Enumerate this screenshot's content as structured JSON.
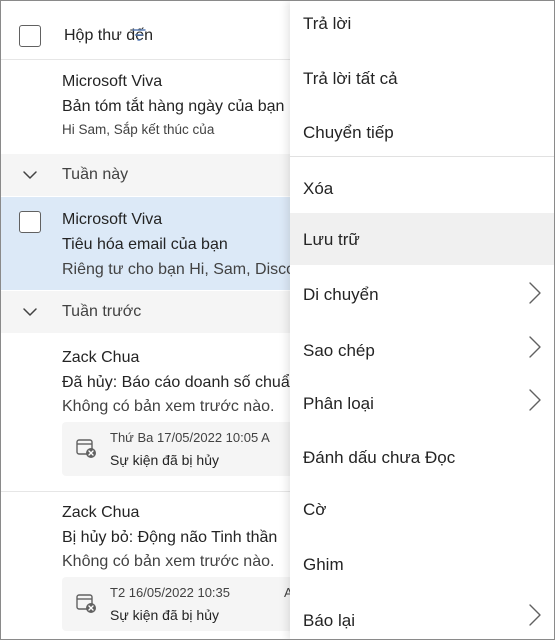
{
  "header": {
    "title": "Hộp thư đến"
  },
  "mails": [
    {
      "sender": "Microsoft Viva",
      "subject": "Bản tóm tắt hàng ngày của bạn",
      "preview": "Hi Sam, Sắp kết thúc của"
    },
    {
      "sender": "Microsoft Viva",
      "subject": "Tiêu hóa email của bạn",
      "preview": "Riêng tư cho bạn Hi, Sam, Disco"
    },
    {
      "sender": "Zack Chua",
      "subject": "Đã hủy: Báo cáo doanh số chuẩn bị",
      "preview": "Không có bản xem trước nào.",
      "card_time": "Thứ Ba 17/05/2022 10:05 A",
      "card_status": "Sự kiện đã bị hủy"
    },
    {
      "sender": "Zack Chua",
      "subject": "Bị hủy bỏ: Động não Tinh thần",
      "preview": "Không có bản xem trước nào.",
      "card_time": "T2 16/05/2022 10:35",
      "card_extra": "A",
      "card_status": "Sự kiện đã bị hủy"
    }
  ],
  "groups": [
    {
      "label": "Tuần này"
    },
    {
      "label": "Tuần trước"
    }
  ],
  "menu": {
    "items": [
      {
        "label": "Trả lời"
      },
      {
        "label": "Trả lời tất cả"
      },
      {
        "label": "Chuyển tiếp"
      },
      {
        "label": "Xóa"
      },
      {
        "label": "Lưu trữ"
      },
      {
        "label": "Di chuyển"
      },
      {
        "label": "Sao chép"
      },
      {
        "label": "Phân loại"
      },
      {
        "label": "Đánh dấu chưa Đọc"
      },
      {
        "label": "Cờ"
      },
      {
        "label": "Ghim"
      },
      {
        "label": "Báo lại"
      }
    ]
  },
  "icons": {
    "header_checkbox": "checkbox-icon",
    "filter": "filter-icon",
    "group_toggle": "chevron-down-icon",
    "calendar_cancelled": "calendar-cancel-icon",
    "submenu": "chevron-right-icon"
  },
  "colors": {
    "selected_row": "#dce9f7",
    "group_bg": "#f5f5f5",
    "menu_hover": "#f0f0f0",
    "text": "#242424"
  }
}
